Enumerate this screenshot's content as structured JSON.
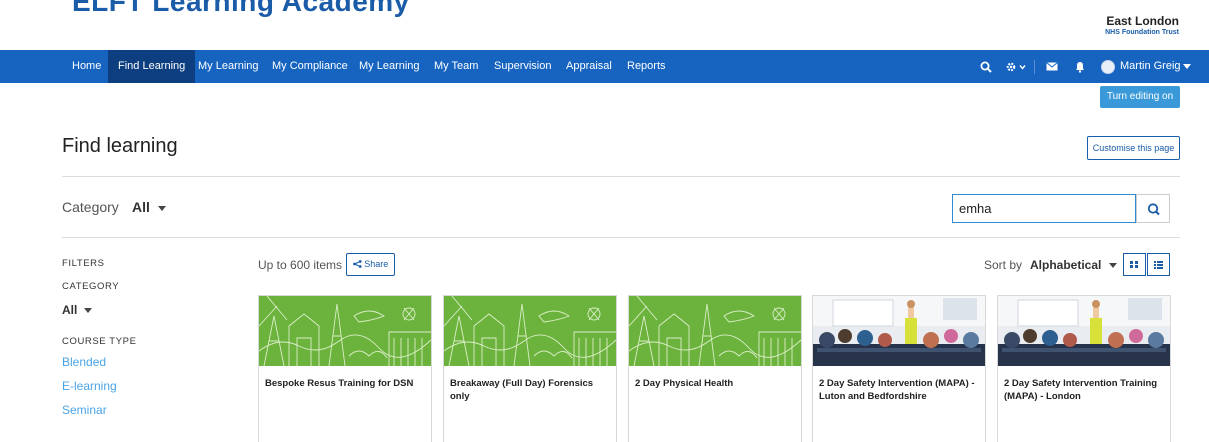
{
  "brand": {
    "title": "ELFT Learning Academy",
    "org_main": "East London",
    "org_sub": "NHS Foundation Trust"
  },
  "nav": {
    "items": [
      "Home",
      "Find Learning",
      "My Learning",
      "My Compliance",
      "My Learning",
      "My Team",
      "Supervision",
      "Appraisal",
      "Reports"
    ],
    "active": "Find Learning",
    "user": "Martin Greig"
  },
  "buttons": {
    "turn_editing": "Turn editing on",
    "customise": "Customise this page",
    "share": "Share"
  },
  "page": {
    "title": "Find learning"
  },
  "category": {
    "label": "Category",
    "value": "All"
  },
  "search": {
    "value": "emha",
    "placeholder": ""
  },
  "filters": {
    "heading": "FILTERS",
    "category_heading": "CATEGORY",
    "category_value": "All",
    "course_type_heading": "COURSE TYPE",
    "course_types": [
      "Blended",
      "E-learning",
      "Seminar"
    ]
  },
  "results": {
    "count_text": "Up to 600 items",
    "sort_label": "Sort by",
    "sort_value": "Alphabetical"
  },
  "cards": [
    {
      "title": "Bespoke Resus Training for DSN",
      "image": "green-illustration"
    },
    {
      "title": "Breakaway (Full Day) Forensics only",
      "image": "green-illustration"
    },
    {
      "title": "2 Day Physical Health",
      "image": "green-illustration"
    },
    {
      "title": "2 Day Safety Intervention (MAPA) - Luton and Bedfordshire",
      "image": "classroom-photo"
    },
    {
      "title": "2 Day Safety Intervention Training (MAPA) - London",
      "image": "classroom-photo"
    }
  ],
  "colors": {
    "nav": "#1664c0",
    "nav_active": "#0d3f80",
    "accent": "#1a5ca8",
    "link": "#4ba4e6",
    "card_green": "#6cb33e"
  }
}
